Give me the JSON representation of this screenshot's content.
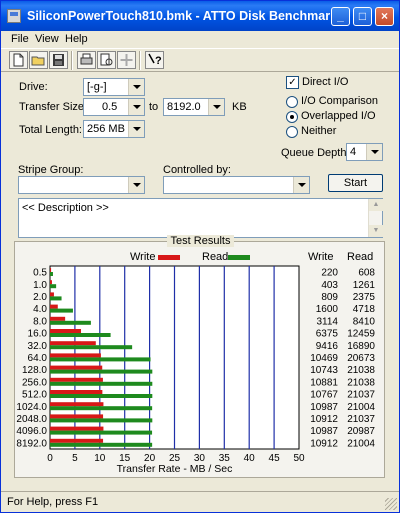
{
  "window": {
    "title": "SiliconPowerTouch810.bmk - ATTO Disk Benchmark",
    "minimize": "_",
    "maximize": "□",
    "close": "×"
  },
  "menu": [
    "File",
    "View",
    "Help"
  ],
  "toolbar": {
    "icons": [
      "new-file-icon",
      "open-folder-icon",
      "save-disk-icon",
      "print-icon",
      "print-preview-icon",
      "move-icon",
      "help-icon"
    ]
  },
  "settings": {
    "drive_label": "Drive:",
    "drive_value": "[-g-]",
    "transfer_size_label": "Transfer Size:",
    "transfer_from": "0.5",
    "to_label": "to",
    "transfer_to": "8192.0",
    "kb_label": "KB",
    "total_length_label": "Total Length:",
    "total_length_value": "256 MB",
    "direct_io_label": "Direct I/O",
    "direct_io_checked": "✓",
    "io_comparison_label": "I/O Comparison",
    "overlapped_io_label": "Overlapped I/O",
    "neither_label": "Neither",
    "queue_depth_label": "Queue Depth:",
    "queue_depth_value": "4",
    "stripe_group_label": "Stripe Group:",
    "controlled_by_label": "Controlled by:",
    "start_label": "Start",
    "description_text": "<< Description >>"
  },
  "results": {
    "title": "Test Results",
    "write_label": "Write",
    "read_label": "Read",
    "write_color": "#d81818",
    "read_color": "#1e8a1e",
    "write_header": "Write",
    "read_header": "Read",
    "xlabel": "Transfer Rate - MB / Sec"
  },
  "chart_data": {
    "type": "bar",
    "orientation": "horizontal",
    "categories": [
      "0.5",
      "1.0",
      "2.0",
      "4.0",
      "8.0",
      "16.0",
      "32.0",
      "64.0",
      "128.0",
      "256.0",
      "512.0",
      "1024.0",
      "2048.0",
      "4096.0",
      "8192.0"
    ],
    "series": [
      {
        "name": "Write",
        "values": [
          220,
          403,
          809,
          1600,
          3114,
          6375,
          9416,
          10469,
          10743,
          10881,
          10767,
          10987,
          10912,
          10987,
          10912
        ]
      },
      {
        "name": "Read",
        "values": [
          608,
          1261,
          2375,
          4718,
          8410,
          12459,
          16890,
          20673,
          21038,
          21038,
          21037,
          21004,
          21037,
          20987,
          21004
        ]
      }
    ],
    "value_unit": "KB/s",
    "xlabel": "Transfer Rate - MB / Sec",
    "xlim": [
      0,
      50
    ],
    "xticks": [
      0,
      5,
      10,
      15,
      20,
      25,
      30,
      35,
      40,
      45,
      50
    ]
  },
  "status": {
    "text": "For Help, press F1"
  }
}
